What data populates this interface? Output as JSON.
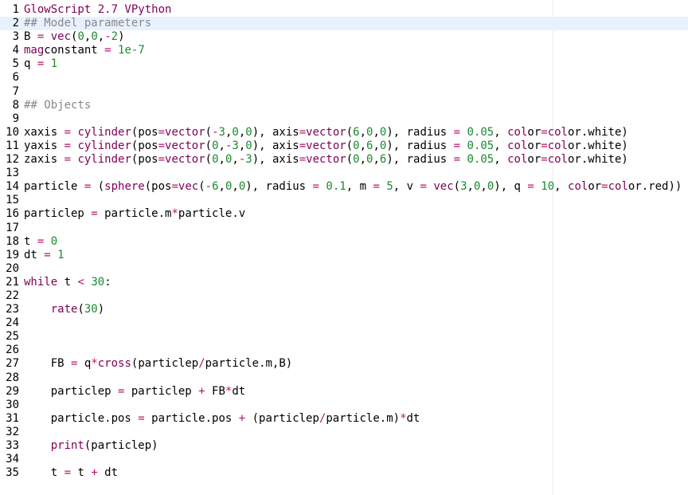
{
  "editor": {
    "lines": [
      {
        "n": "1",
        "text": "GlowScript 2.7 VPython"
      },
      {
        "n": "2",
        "text": "## Model parameters"
      },
      {
        "n": "3",
        "text": "B = vec(0,0,-2)"
      },
      {
        "n": "4",
        "text": "magconstant = 1e-7"
      },
      {
        "n": "5",
        "text": "q = 1"
      },
      {
        "n": "6",
        "text": ""
      },
      {
        "n": "7",
        "text": ""
      },
      {
        "n": "8",
        "text": "## Objects"
      },
      {
        "n": "9",
        "text": ""
      },
      {
        "n": "10",
        "text": "xaxis = cylinder(pos=vector(-3,0,0), axis=vector(6,0,0), radius = 0.05, color=color.white)"
      },
      {
        "n": "11",
        "text": "yaxis = cylinder(pos=vector(0,-3,0), axis=vector(0,6,0), radius = 0.05, color=color.white)"
      },
      {
        "n": "12",
        "text": "zaxis = cylinder(pos=vector(0,0,-3), axis=vector(0,0,6), radius = 0.05, color=color.white)"
      },
      {
        "n": "13",
        "text": ""
      },
      {
        "n": "14",
        "text": "particle = (sphere(pos=vec(-6,0,0), radius = 0.1, m = 5, v = vec(3,0,0), q = 10, color=color.red))"
      },
      {
        "n": "15",
        "text": ""
      },
      {
        "n": "16",
        "text": "particlep = particle.m*particle.v"
      },
      {
        "n": "17",
        "text": ""
      },
      {
        "n": "18",
        "text": "t = 0"
      },
      {
        "n": "19",
        "text": "dt = 1"
      },
      {
        "n": "20",
        "text": ""
      },
      {
        "n": "21",
        "text": "while t < 30:"
      },
      {
        "n": "22",
        "text": ""
      },
      {
        "n": "23",
        "text": "    rate(30)"
      },
      {
        "n": "24",
        "text": ""
      },
      {
        "n": "25",
        "text": ""
      },
      {
        "n": "26",
        "text": ""
      },
      {
        "n": "27",
        "text": "    FB = q*cross(particlep/particle.m,B)"
      },
      {
        "n": "28",
        "text": ""
      },
      {
        "n": "29",
        "text": "    particlep = particlep + FB*dt"
      },
      {
        "n": "30",
        "text": ""
      },
      {
        "n": "31",
        "text": "    particle.pos = particle.pos + (particlep/particle.m)*dt"
      },
      {
        "n": "32",
        "text": ""
      },
      {
        "n": "33",
        "text": "    print(particlep)"
      },
      {
        "n": "34",
        "text": ""
      },
      {
        "n": "35",
        "text": "    t = t + dt"
      }
    ],
    "current_line": "2",
    "colors": {
      "keyword": "#7f0055",
      "operator": "#b5146b",
      "number": "#1a8a2f",
      "comment": "#888888",
      "current_line_bg": "#e8f2fe"
    }
  }
}
